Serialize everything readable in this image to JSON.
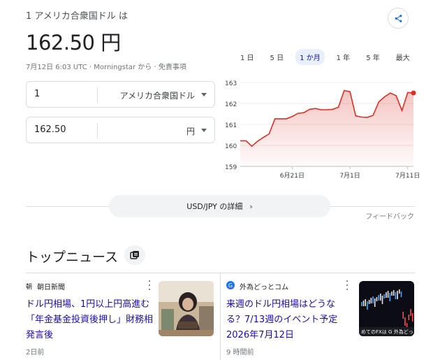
{
  "header": {
    "subtitle": "1 アメリカ合衆国ドル は",
    "rate": "162.50 円",
    "meta": "7月12日 6:03 UTC · Morningstar から · 免責事項"
  },
  "converter": {
    "from_value": "1",
    "from_currency": "アメリカ合衆国ドル",
    "to_value": "162.50",
    "to_currency": "円"
  },
  "ranges": [
    "1 日",
    "5 日",
    "1 か月",
    "1 年",
    "5 年",
    "最大"
  ],
  "active_range": "1 か月",
  "chart_data": {
    "type": "area",
    "title": "",
    "xlabel": "",
    "ylabel": "",
    "ylim": [
      159,
      163
    ],
    "yticks": [
      159,
      160,
      161,
      162,
      163
    ],
    "xticks": [
      {
        "label": "6月21日",
        "index": 9
      },
      {
        "label": "7月1日",
        "index": 19
      },
      {
        "label": "7月11日",
        "index": 29
      }
    ],
    "grid": true,
    "line_color": "#d93025",
    "values": [
      160.22,
      160.22,
      159.96,
      160.2,
      160.38,
      160.55,
      161.27,
      161.27,
      161.27,
      161.38,
      161.53,
      161.56,
      161.72,
      161.76,
      161.7,
      161.7,
      161.72,
      161.82,
      162.62,
      162.56,
      161.41,
      161.35,
      161.34,
      161.43,
      162.08,
      162.32,
      162.5,
      162.37,
      161.66,
      162.52,
      162.5
    ],
    "last_value": 162.5
  },
  "details_button": "USD/JPY の詳細",
  "feedback": "フィードバック",
  "news": {
    "title": "トップニュース",
    "cards": [
      {
        "source_icon": "朝",
        "source": "朝日新聞",
        "headline": "ドル円相場、1円以上円高進む 「年金基金投資後押し」財務相発言後",
        "age": "2日前"
      },
      {
        "source_icon": "G",
        "source": "外為どっとコム",
        "headline": "来週のドル円相場はどうなる？7/13週のイベント予定 2026年7月12日",
        "age": "9 時間前",
        "thumb_caption": "めてのFXは G 外為どっ"
      }
    ]
  },
  "colors": {
    "link": "#1a0dab",
    "accent": "#1a73e8",
    "chart_line": "#d93025"
  }
}
